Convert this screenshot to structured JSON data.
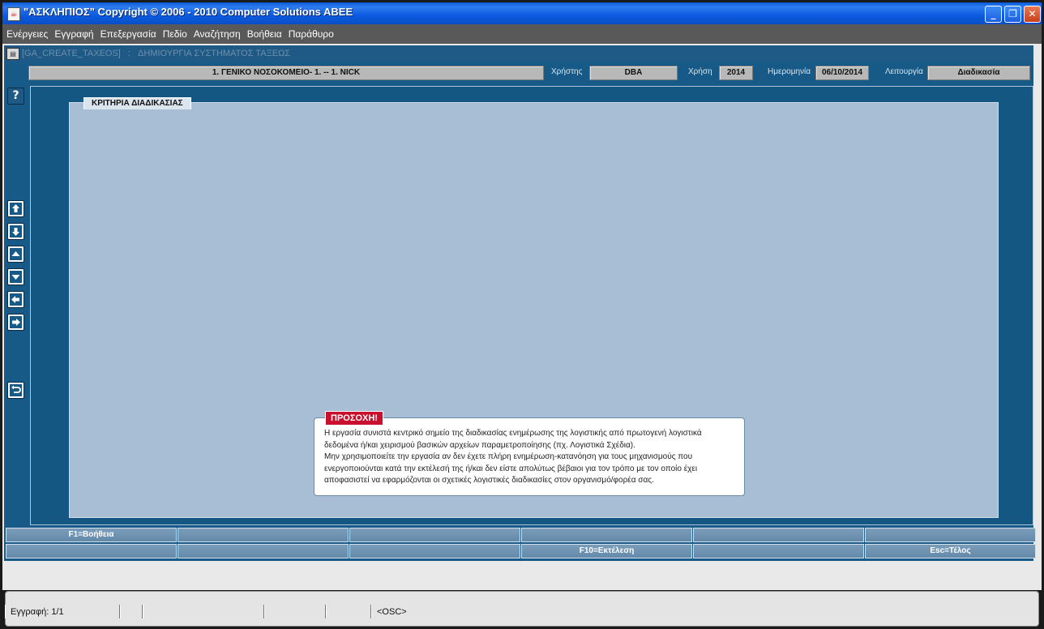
{
  "window": {
    "title": "\"ΑΣΚΛΗΠΙΟΣ\" Copyright © 2006 - 2010 Computer Solutions ABEE",
    "minimize": "_",
    "restore": "❐",
    "close": "✕"
  },
  "menu": [
    "Ενέργειες",
    "Εγγραφή",
    "Επεξεργασία",
    "Πεδίο",
    "Αναζήτηση",
    "Βοήθεια",
    "Παράθυρο"
  ],
  "form": {
    "code": "[GA_CREATE_TAXEOS]",
    "separator": ":",
    "name": "ΔΗΜΙΟΥΡΓΙΑ ΣΥΣΤΗΜΑΤΟΣ ΤΑΞΕΩΣ"
  },
  "header": {
    "organization": "1. ΓΕΝΙΚΟ ΝΟΣΟΚΟΜΕΙΟ- 1. -- 1. NICK",
    "user_label": "Χρήστης",
    "user_value": "DBA",
    "year_label": "Χρήση",
    "year_value": "2014",
    "date_label": "Ημερομηνία",
    "date_value": "06/10/2014",
    "function_label": "Λειτουργία",
    "function_value": "Διαδικασία"
  },
  "panel": {
    "tab_label": "ΚΡΙΤΗΡΙΑ ΔΙΑΔΙΚΑΣΙΑΣ"
  },
  "warning": {
    "badge": "ΠΡΟΣΟΧΗ!",
    "text": "Η εργασία συνιστά κεντρικό σημείο της διαδικασίας ενημέρωσης της λογιστικής από πρωτογενή λογιστικά\nδεδομένα ή/και χειρισμού βασικών αρχείων παραμετροποίησης (πχ. Λογιστικά Σχέδια).\nΜην χρησιμοποιείτε την εργασία αν δεν έχετε πλήρη ενημέρωση-κατανόηση για τους μηχανισμούς που\nενεργοποιούνται κατά την εκτέλεσή της ή/και δεν είστε απολύτως βέβαιοι για τον τρόπο με τον οποίο έχει\nαποφασιστεί να εφαρμόζονται οι σχετικές λογιστικές διαδικασίες στον οργανισμό/φορέα σας."
  },
  "side_buttons": {
    "help": "?"
  },
  "function_keys": {
    "row1": [
      "F1=Βοήθεια",
      "",
      "",
      "",
      "",
      ""
    ],
    "row2": [
      "",
      "",
      "",
      "F10=Εκτέλεση",
      "",
      "Esc=Τέλος"
    ]
  },
  "status": {
    "record": "Εγγραφή: 1/1",
    "mode": "<OSC>"
  }
}
